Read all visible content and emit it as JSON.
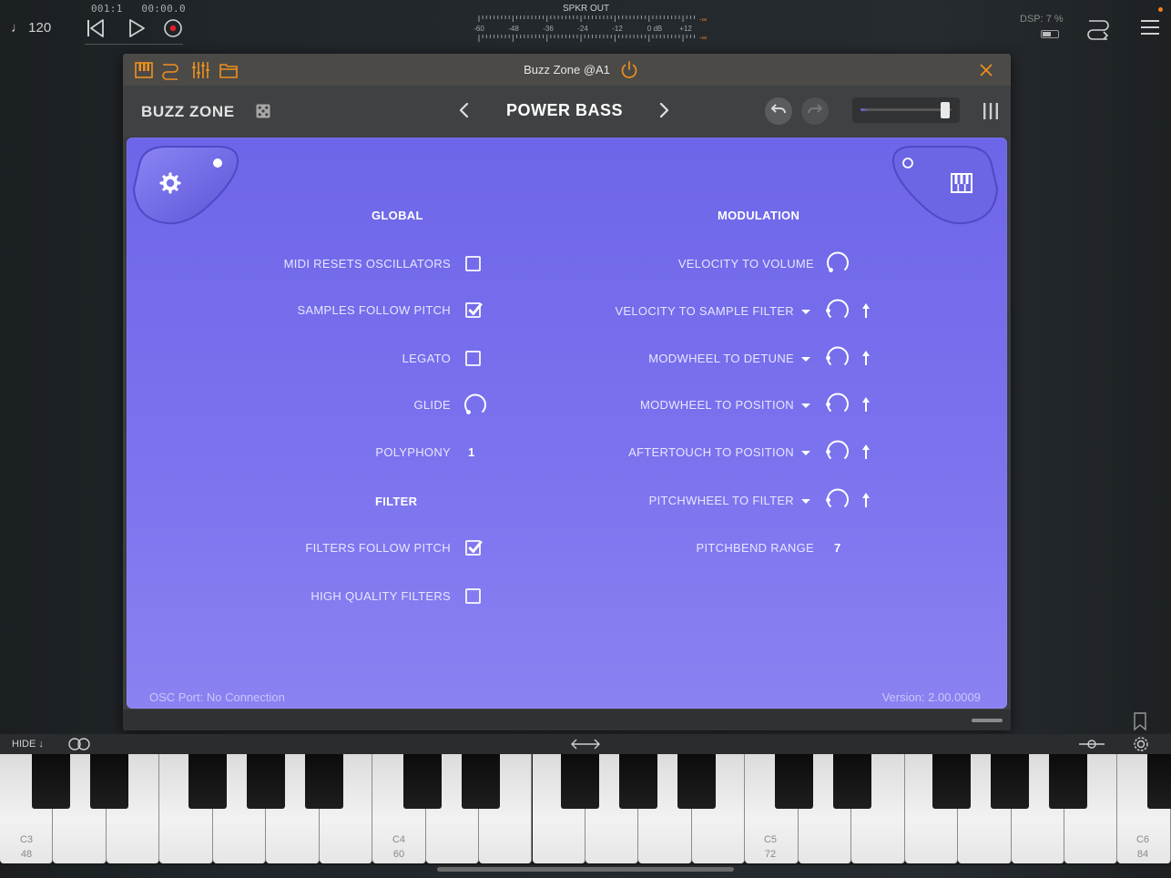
{
  "transport": {
    "tempo": "♩ 120",
    "position_bars": "001:1",
    "position_time": "00:00.0"
  },
  "meter": {
    "title": "SPKR OUT",
    "scale": [
      "-60",
      "-48",
      "-36",
      "-24",
      "-12",
      "0 dB",
      "+12"
    ],
    "peak_left": "-∞",
    "peak_right": "-∞"
  },
  "status": {
    "dsp": "DSP:  7 %"
  },
  "plugin": {
    "title": "Buzz Zone @A1",
    "brand": "BUZZ ZONE",
    "preset_name": "POWER BASS",
    "volume_level": 0.92,
    "accent_color": "#f0901e",
    "panel_color": "#7b72ee"
  },
  "global": {
    "title": "GLOBAL",
    "rows": [
      {
        "label": "MIDI RESETS OSCILLATORS",
        "type": "checkbox",
        "checked": false
      },
      {
        "label": "SAMPLES FOLLOW PITCH",
        "type": "checkbox",
        "checked": true
      },
      {
        "label": "LEGATO",
        "type": "checkbox",
        "checked": false
      },
      {
        "label": "GLIDE",
        "type": "knob"
      },
      {
        "label": "POLYPHONY",
        "type": "value",
        "value": "1"
      }
    ]
  },
  "filter": {
    "title": "FILTER",
    "rows": [
      {
        "label": "FILTERS FOLLOW PITCH",
        "type": "checkbox",
        "checked": true
      },
      {
        "label": "HIGH QUALITY FILTERS",
        "type": "checkbox",
        "checked": false
      }
    ]
  },
  "modulation": {
    "title": "MODULATION",
    "rows": [
      {
        "label": "VELOCITY TO VOLUME",
        "type": "knob"
      },
      {
        "label": "VELOCITY TO SAMPLE FILTER",
        "type": "knob-dropdown"
      },
      {
        "label": "MODWHEEL TO DETUNE",
        "type": "knob-dropdown"
      },
      {
        "label": "MODWHEEL TO POSITION",
        "type": "knob-dropdown"
      },
      {
        "label": "AFTERTOUCH TO POSITION",
        "type": "knob-dropdown"
      },
      {
        "label": "PITCHWHEEL TO FILTER",
        "type": "knob-dropdown"
      },
      {
        "label": "PITCHBEND RANGE",
        "type": "value",
        "value": "7"
      }
    ]
  },
  "footer": {
    "osc_port": "OSC Port: No Connection",
    "version": "Version: 2.00.0009"
  },
  "keyboard": {
    "hide_label": "HIDE ↓",
    "octave_labels": [
      {
        "note": "C3",
        "number": "48"
      },
      {
        "note": "C4",
        "number": "60"
      },
      {
        "note": "C5",
        "number": "72"
      },
      {
        "note": "C6",
        "number": "84"
      }
    ]
  }
}
